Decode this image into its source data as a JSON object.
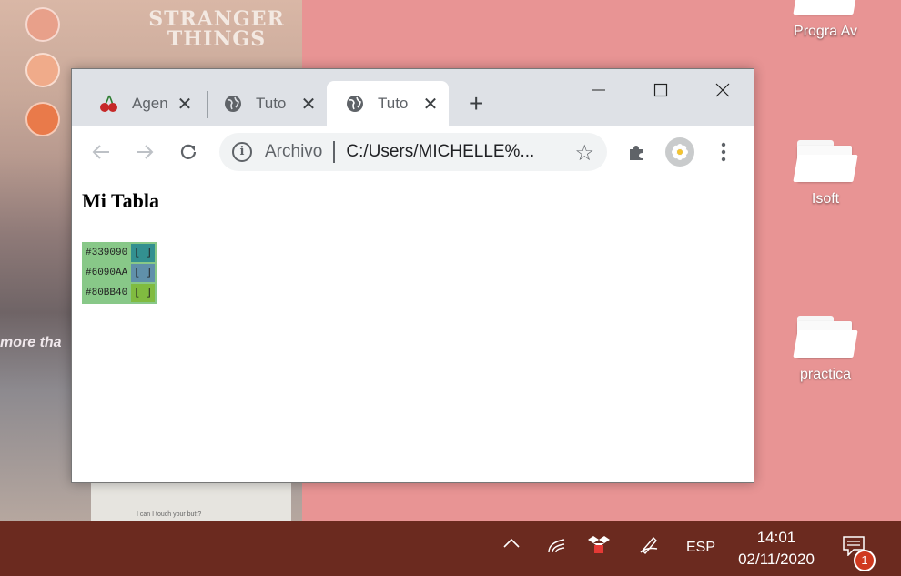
{
  "desktop": {
    "icons": [
      {
        "label": "Progra Av"
      },
      {
        "label": "Isoft"
      },
      {
        "label": "practica"
      }
    ],
    "wallpaper_text": {
      "title": "STRANGER THINGS",
      "caption": "more tha",
      "card": "I can I touch your butt?"
    }
  },
  "browser": {
    "tabs": [
      {
        "label": "Agen",
        "icon": "cherry-icon",
        "active": false
      },
      {
        "label": "Tuto",
        "icon": "globe-icon",
        "active": false
      },
      {
        "label": "Tuto",
        "icon": "globe-icon",
        "active": true
      }
    ],
    "omnibox": {
      "chip": "Archivo",
      "url": "C:/Users/MICHELLE%..."
    },
    "colors": {
      "tabbar": "#dee1e6",
      "toolbar": "#ffffff"
    }
  },
  "page": {
    "title": "Mi Tabla",
    "color_rows": [
      {
        "hex": "#339090",
        "swatch": "[ ]",
        "color": "#339090"
      },
      {
        "hex": "#6090AA",
        "swatch": "[ ]",
        "color": "#6090AA"
      },
      {
        "hex": "#80BB40",
        "swatch": "[ ]",
        "color": "#80BB40"
      }
    ]
  },
  "taskbar": {
    "language": "ESP",
    "time": "14:01",
    "date": "02/11/2020",
    "notification_count": "1",
    "color": "#6b2a1f"
  }
}
